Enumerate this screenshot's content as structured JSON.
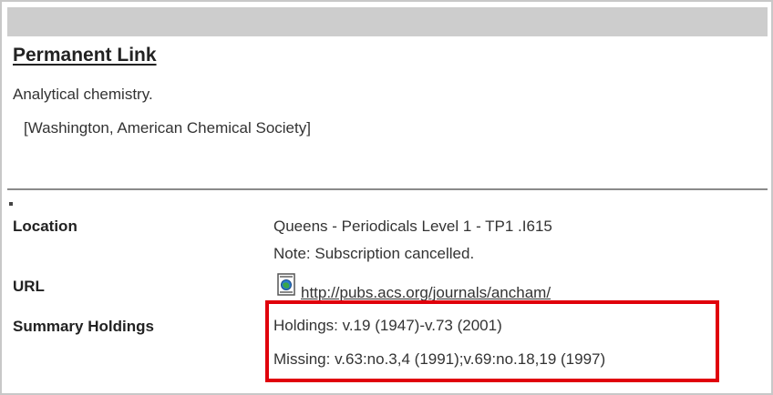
{
  "header": {
    "permanent_link": "Permanent Link"
  },
  "record": {
    "title": "Analytical chemistry.",
    "publisher": "[Washington, American Chemical Society]"
  },
  "fields": {
    "location_label": "Location",
    "location_value": "Queens - Periodicals Level 1 - TP1 .I615",
    "location_note": "Note: Subscription cancelled.",
    "url_label": "URL",
    "url_value": "http://pubs.acs.org/journals/ancham/",
    "url_icon": "document-web-icon",
    "holdings_label": "Summary Holdings",
    "holdings_value": "Holdings: v.19 (1947)-v.73 (2001)",
    "missing_value": "Missing: v.63:no.3,4 (1991);v.69:no.18,19 (1997)"
  },
  "colors": {
    "highlight_border": "#e0000b",
    "header_bar": "#cdcdcd"
  }
}
